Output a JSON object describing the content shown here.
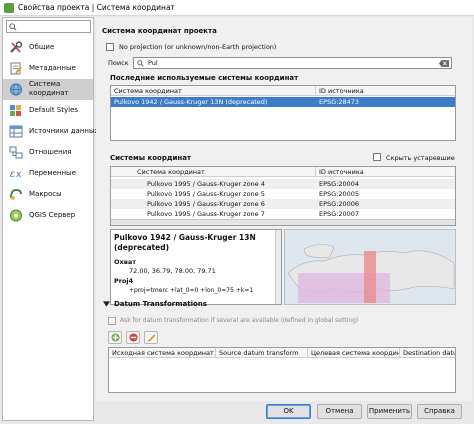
{
  "window": {
    "title": "Свойства проекта | Система координат"
  },
  "sidebar": {
    "search_placeholder": "",
    "items": [
      {
        "label": "Общие",
        "icon": "wrench-icon"
      },
      {
        "label": "Метаданные",
        "icon": "document-edit-icon"
      },
      {
        "label": "Система координат",
        "icon": "globe-icon"
      },
      {
        "label": "Default Styles",
        "icon": "palette-icon"
      },
      {
        "label": "Источники данных",
        "icon": "table-icon"
      },
      {
        "label": "Отношения",
        "icon": "relations-icon"
      },
      {
        "label": "Переменные",
        "icon": "variables-icon"
      },
      {
        "label": "Макросы",
        "icon": "macro-icon"
      },
      {
        "label": "QGIS Сервер",
        "icon": "server-icon"
      }
    ],
    "active_index": 2
  },
  "crs": {
    "section_title": "Система координат проекта",
    "no_projection_label": "No projection (or unknown/non-Earth projection)",
    "filter_label": "Поиск",
    "filter_value": "Pul",
    "recent_title": "Последние используемые системы координат",
    "recent_headers": [
      "Система координат",
      "ID источника"
    ],
    "recent_rows": [
      {
        "name": "Pulkovo 1942 / Gauss-Kruger 13N (deprecated)",
        "id": "EPSG:28473",
        "selected": true
      }
    ],
    "systems_title": "Системы координат",
    "hide_deprecated_label": "Скрыть устаревшие",
    "systems_headers": [
      "Система координат",
      "ID источника"
    ],
    "systems_rows": [
      {
        "name": "Pulkovo 1995 / Gauss-Kruger zone 4",
        "id": "EPSG:20004"
      },
      {
        "name": "Pulkovo 1995 / Gauss-Kruger zone 5",
        "id": "EPSG:20005"
      },
      {
        "name": "Pulkovo 1995 / Gauss-Kruger zone 6",
        "id": "EPSG:20006"
      },
      {
        "name": "Pulkovo 1995 / Gauss-Kruger zone 7",
        "id": "EPSG:20007"
      }
    ],
    "info": {
      "title": "Pulkovo 1942 / Gauss-Kruger 13N (deprecated)",
      "extent_label": "Охват",
      "extent_value": "72.00, 36.79, 78.00, 79.71",
      "proj_label": "Proj4",
      "proj_value": "+proj=tmerc +lat_0=0 +lon_0=75 +k=1"
    }
  },
  "datum": {
    "section_title": "Datum Transformations",
    "ask_label": "Ask for datum transformation if several are available (defined in global setting)",
    "headers": [
      "Исходная система координат",
      "Source datum transform",
      "Целевая система координат",
      "Destination datum"
    ]
  },
  "buttons": {
    "ok": "OK",
    "cancel": "Отмена",
    "apply": "Применить",
    "help": "Справка"
  },
  "colors": {
    "selection": "#3d7cc9",
    "map_highlight": "#e07070",
    "map_extent": "#d8a0d8"
  }
}
